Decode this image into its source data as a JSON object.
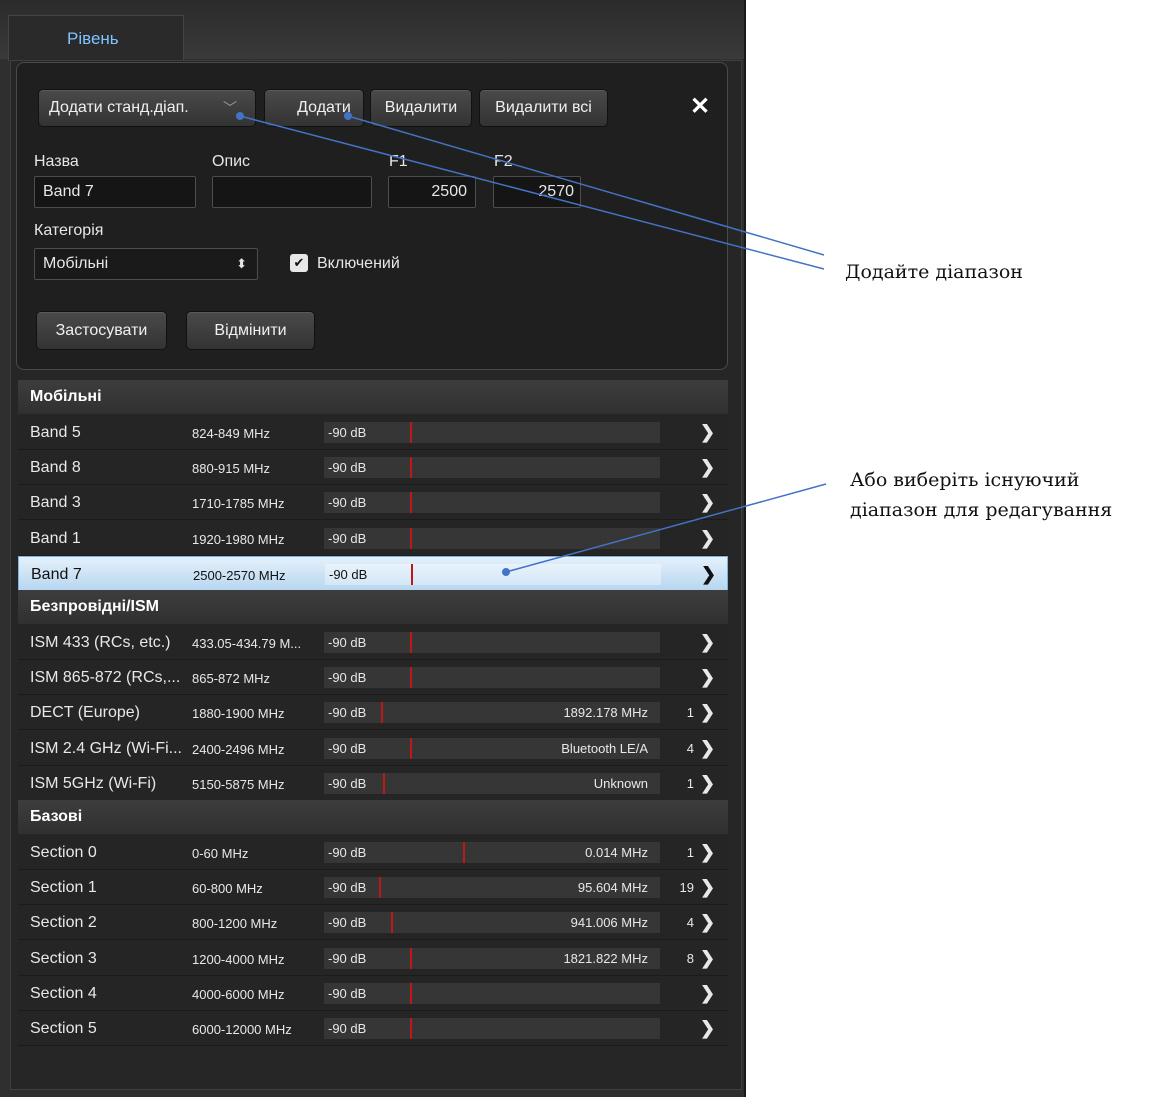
{
  "tab": {
    "label": "Рівень"
  },
  "editor": {
    "add_standard_label": "Додати станд.діап.",
    "add_label": "Додати",
    "delete_label": "Видалити",
    "delete_all_label": "Видалити всі",
    "close_glyph": "✕",
    "name_label": "Назва",
    "desc_label": "Опис",
    "f1_label": "F1",
    "f2_label": "F2",
    "name_value": "Band 7",
    "desc_value": "",
    "f1_value": "2500",
    "f2_value": "2570",
    "category_label": "Категорія",
    "category_value": "Мобільні",
    "enabled_label": "Включений",
    "enabled_checked": true,
    "apply_label": "Застосувати",
    "cancel_label": "Відмінити"
  },
  "groups": [
    {
      "title": "Мобільні",
      "rows": [
        {
          "name": "Band 5",
          "range": "824-849 MHz",
          "db": "-90 dB",
          "value": "",
          "count": "",
          "level": 0.255
        },
        {
          "name": "Band 8",
          "range": "880-915 MHz",
          "db": "-90 dB",
          "value": "",
          "count": "",
          "level": 0.255
        },
        {
          "name": "Band 3",
          "range": "1710-1785 MHz",
          "db": "-90 dB",
          "value": "",
          "count": "",
          "level": 0.255
        },
        {
          "name": "Band 1",
          "range": "1920-1980 MHz",
          "db": "-90 dB",
          "value": "",
          "count": "",
          "level": 0.255
        },
        {
          "name": "Band 7",
          "range": "2500-2570 MHz",
          "db": "-90 dB",
          "value": "",
          "count": "",
          "level": 0.255,
          "selected": true
        }
      ]
    },
    {
      "title": "Безпровідні/ISM",
      "rows": [
        {
          "name": "ISM 433 (RCs, etc.)",
          "range": "433.05-434.79 M...",
          "db": "-90 dB",
          "value": "",
          "count": "",
          "level": 0.255
        },
        {
          "name": "ISM 865-872 (RCs,...",
          "range": "865-872 MHz",
          "db": "-90 dB",
          "value": "",
          "count": "",
          "level": 0.255
        },
        {
          "name": "DECT (Europe)",
          "range": "1880-1900 MHz",
          "db": "-90 dB",
          "value": "1892.178 MHz",
          "count": "1",
          "level": 0.17
        },
        {
          "name": "ISM 2.4 GHz (Wi-Fi...",
          "range": "2400-2496 MHz",
          "db": "-90 dB",
          "value": "Bluetooth LE/A",
          "count": "4",
          "level": 0.255
        },
        {
          "name": "ISM 5GHz (Wi-Fi)",
          "range": "5150-5875 MHz",
          "db": "-90 dB",
          "value": "Unknown",
          "count": "1",
          "level": 0.175
        }
      ]
    },
    {
      "title": "Базові",
      "rows": [
        {
          "name": "Section 0",
          "range": "0-60 MHz",
          "db": "-90 dB",
          "value": "0.014 MHz",
          "count": "1",
          "level": 0.415
        },
        {
          "name": "Section 1",
          "range": "60-800 MHz",
          "db": "-90 dB",
          "value": "95.604 MHz",
          "count": "19",
          "level": 0.165
        },
        {
          "name": "Section 2",
          "range": "800-1200 MHz",
          "db": "-90 dB",
          "value": "941.006 MHz",
          "count": "4",
          "level": 0.2
        },
        {
          "name": "Section 3",
          "range": "1200-4000 MHz",
          "db": "-90 dB",
          "value": "1821.822 MHz",
          "count": "8",
          "level": 0.255
        },
        {
          "name": "Section 4",
          "range": "4000-6000 MHz",
          "db": "-90 dB",
          "value": "",
          "count": "",
          "level": 0.255
        },
        {
          "name": "Section 5",
          "range": "6000-12000 MHz",
          "db": "-90 dB",
          "value": "",
          "count": "",
          "level": 0.255
        }
      ]
    }
  ],
  "annotations": {
    "add_range": "Додайте діапазон",
    "select_existing_line1": "Або виберіть існуючий",
    "select_existing_line2": "діапазон для редагування"
  },
  "colors": {
    "accent": "#7fc4ff",
    "marker": "#c01818",
    "annotation_line": "#4472c4"
  }
}
